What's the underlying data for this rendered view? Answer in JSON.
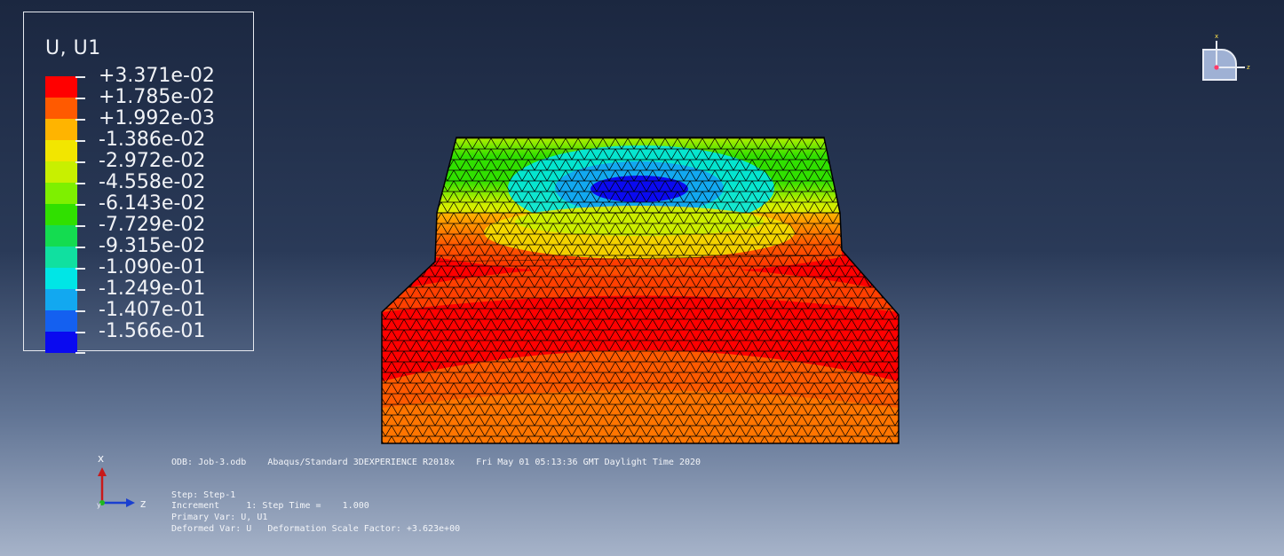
{
  "legend": {
    "title": "U, U1",
    "levels": [
      {
        "label": "+3.371e-02",
        "color": "#ff0000"
      },
      {
        "label": "+1.785e-02",
        "color": "#ff5a00"
      },
      {
        "label": "+1.992e-03",
        "color": "#ffb400"
      },
      {
        "label": "-1.386e-02",
        "color": "#f2e600"
      },
      {
        "label": "-2.972e-02",
        "color": "#c8f000"
      },
      {
        "label": "-4.558e-02",
        "color": "#7ef000"
      },
      {
        "label": "-6.143e-02",
        "color": "#30e000"
      },
      {
        "label": "-7.729e-02",
        "color": "#14dc50"
      },
      {
        "label": "-9.315e-02",
        "color": "#10e0a0"
      },
      {
        "label": "-1.090e-01",
        "color": "#00e6e6"
      },
      {
        "label": "-1.249e-01",
        "color": "#12a8f0"
      },
      {
        "label": "-1.407e-01",
        "color": "#1460f0"
      },
      {
        "label": "-1.566e-01",
        "color": "#0a0af0"
      }
    ]
  },
  "info": {
    "odb_line": "ODB: Job-3.odb    Abaqus/Standard 3DEXPERIENCE R2018x    Fri May 01 05:13:36 GMT Daylight Time 2020",
    "step": "Step: Step-1",
    "increment": "Increment     1: Step Time =    1.000",
    "primary_var": "Primary Var: U, U1",
    "deformed_var": "Deformed Var: U   Deformation Scale Factor: +3.623e+00"
  },
  "axes": {
    "x_label": "x",
    "z_label": "z",
    "y_label": "y"
  },
  "triad": {
    "x_label": "x",
    "z_label": "z"
  },
  "colors": {
    "red": "#ff0000",
    "orange": "#ff5a00",
    "amber": "#ffb400",
    "yellow": "#f2e600",
    "lime": "#c8f000",
    "green": "#30e000",
    "cyan": "#00e6e6",
    "blue": "#1460f0",
    "navy": "#0a0af0",
    "mesh_line": "#000000"
  }
}
